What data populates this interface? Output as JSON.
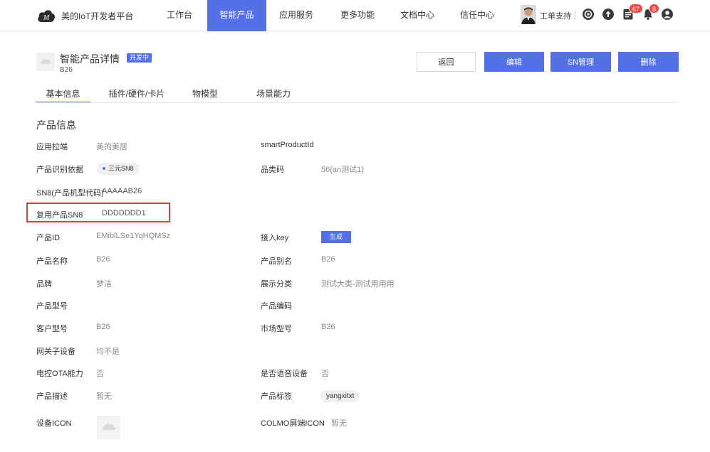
{
  "nav": {
    "brand": "美的IoT开发者平台",
    "items": [
      "工作台",
      "智能产品",
      "应用服务",
      "更多功能",
      "文档中心",
      "信任中心"
    ],
    "active_index": 1,
    "user_name": "工单支持",
    "badges": {
      "list": "67",
      "bell": "8"
    }
  },
  "header": {
    "title": "智能产品详情",
    "status": "开发中",
    "subtitle": "B26",
    "buttons": {
      "back": "返回",
      "edit": "编辑",
      "sn": "SN管理",
      "delete": "删除"
    }
  },
  "tabs": [
    "基本信息",
    "插件/硬件/卡片",
    "物模型",
    "场景能力"
  ],
  "active_tab": 0,
  "section_title": "产品信息",
  "fields": {
    "app_pull": {
      "label": "应用拉端",
      "value": "美的美居"
    },
    "smart_product_id": {
      "label": "smartProductId",
      "value": ""
    },
    "id_basis": {
      "label": "产品识别依据",
      "value": "三元SN8"
    },
    "category_code": {
      "label": "品类码",
      "value": "56(an测试1)"
    },
    "sn8": {
      "label": "SN8(产品机型代码)",
      "value": "AAAAAB26"
    },
    "reuse_sn8": {
      "label": "复用产品SN8",
      "value": "DDDDDDD1"
    },
    "product_id": {
      "label": "产品ID",
      "value": "EMiblLSe1YqHQMSz"
    },
    "access_key": {
      "label": "接入key",
      "value": "生成"
    },
    "product_name": {
      "label": "产品名称",
      "value": "B26"
    },
    "product_alias": {
      "label": "产品别名",
      "value": "B26"
    },
    "brand": {
      "label": "品牌",
      "value": "梦洁"
    },
    "display_category": {
      "label": "展示分类",
      "value": "测试大类-测试用用用"
    },
    "product_model": {
      "label": "产品型号",
      "value": ""
    },
    "product_code": {
      "label": "产品编码",
      "value": ""
    },
    "customer_model": {
      "label": "客户型号",
      "value": "B26"
    },
    "market_model": {
      "label": "市场型号",
      "value": "B26"
    },
    "gateway_sub": {
      "label": "网关子设备",
      "value": "均不是"
    },
    "ota": {
      "label": "电控OTA能力",
      "value": "否"
    },
    "voice": {
      "label": "是否语音设备",
      "value": "否"
    },
    "description": {
      "label": "产品描述",
      "value": "暂无"
    },
    "tags": {
      "label": "产品标签",
      "value": "yangxitxt"
    },
    "device_icon": {
      "label": "设备ICON",
      "value": ""
    },
    "colmo_icon": {
      "label": "COLMO屏端ICON",
      "value": "暂无"
    }
  },
  "colors": {
    "accent": "#5470e6",
    "highlight": "#e53935",
    "badge": "#f04747"
  }
}
